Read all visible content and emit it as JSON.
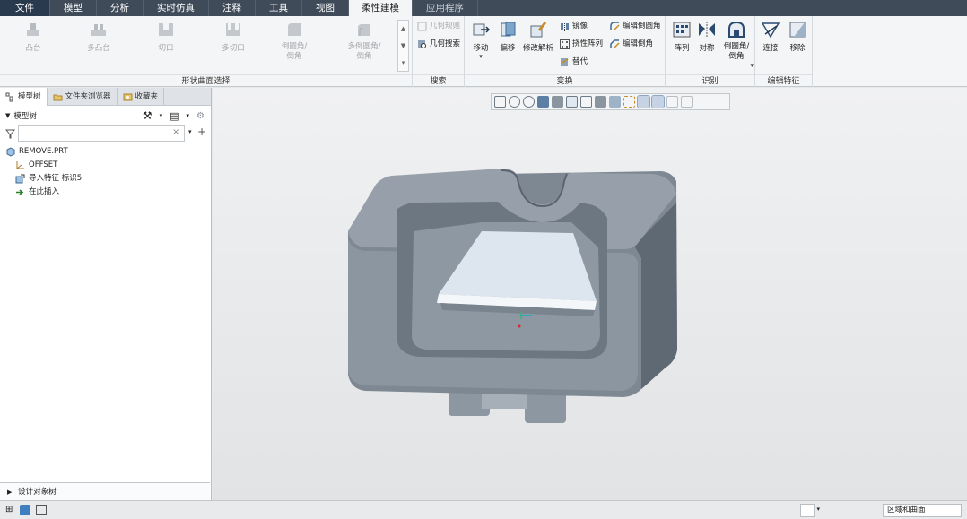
{
  "menu": {
    "tabs": [
      "文件",
      "模型",
      "分析",
      "实时仿真",
      "注释",
      "工具",
      "视图",
      "柔性建模",
      "应用程序"
    ],
    "active": "柔性建模"
  },
  "ribbon": {
    "shape_group": {
      "label": "形状曲面选择",
      "items": [
        "凸台",
        "多凸台",
        "切口",
        "多切口",
        "倒圆角/\n倒角",
        "多倒圆角/\n倒角"
      ]
    },
    "search_group": {
      "label": "搜索",
      "items": [
        "几何规则",
        "几何搜索"
      ]
    },
    "transform_group": {
      "label": "变换",
      "move": "移动",
      "offset": "偏移",
      "modify_analysis": "修改解析",
      "mirror": "镜像",
      "flex_pattern": "挠性阵列",
      "substitute": "替代",
      "edit_round": "编辑倒圆角",
      "edit_chamfer": "编辑倒角"
    },
    "recognize_group": {
      "label": "识别",
      "pattern": "阵列",
      "symmetry": "对称",
      "round_chamfer": "倒圆角/\n倒角"
    },
    "edit_feature_group": {
      "label": "编辑特征",
      "connect": "连接",
      "remove": "移除"
    }
  },
  "panel": {
    "tabs": [
      "模型树",
      "文件夹浏览器",
      "收藏夹"
    ],
    "title": "模型树",
    "tree": [
      {
        "label": "REMOVE.PRT",
        "icon": "part-icon"
      },
      {
        "label": "OFFSET",
        "icon": "csys-icon"
      },
      {
        "label": "导入特征 标识5",
        "icon": "import-feature-icon"
      },
      {
        "label": "在此插入",
        "icon": "insert-here-icon"
      }
    ],
    "design_tree": "设计对象树"
  },
  "status": {
    "selection_filter": "区域和曲面"
  },
  "colors": {
    "menubar": "#3f4b59",
    "file_tab": "#2a3a4e",
    "model_gray": "#8b959f",
    "model_face_light": "#dde6ef"
  }
}
